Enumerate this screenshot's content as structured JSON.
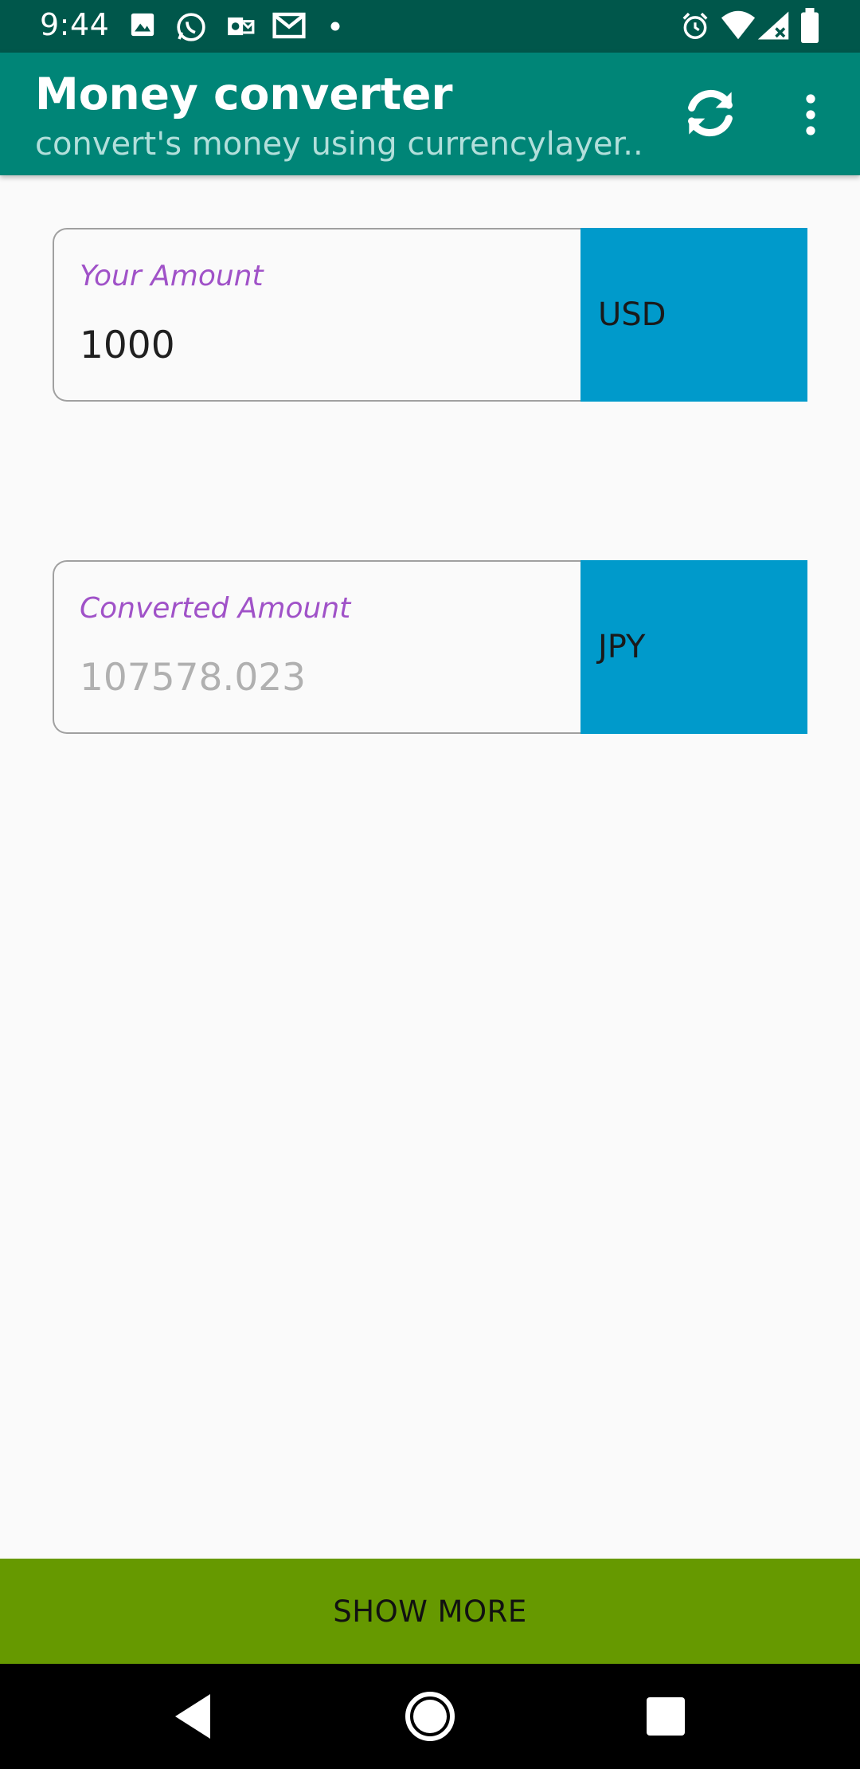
{
  "status_bar": {
    "time": "9:44",
    "left_icons": [
      "image-icon",
      "whatsapp-icon",
      "outlook-icon",
      "gmail-icon",
      "dot-icon"
    ],
    "right_icons": [
      "alarm-icon",
      "wifi-icon",
      "signal-icon",
      "battery-icon"
    ]
  },
  "app_bar": {
    "title": "Money converter",
    "subtitle": "convert's money using currencylayer....",
    "actions": [
      "refresh-icon",
      "more-vert-icon"
    ]
  },
  "source": {
    "label": "Your Amount",
    "value": "1000",
    "currency": "USD"
  },
  "target": {
    "label": "Converted Amount",
    "value": "107578.023",
    "currency": "JPY"
  },
  "show_more_label": "SHOW MORE",
  "colors": {
    "status_bar": "#00574b",
    "app_bar": "#008577",
    "accent_label": "#a052c8",
    "currency_box": "#009acb",
    "show_more": "#669900"
  },
  "nav_bar": {
    "buttons": [
      "back-icon",
      "home-icon",
      "recents-icon"
    ]
  }
}
